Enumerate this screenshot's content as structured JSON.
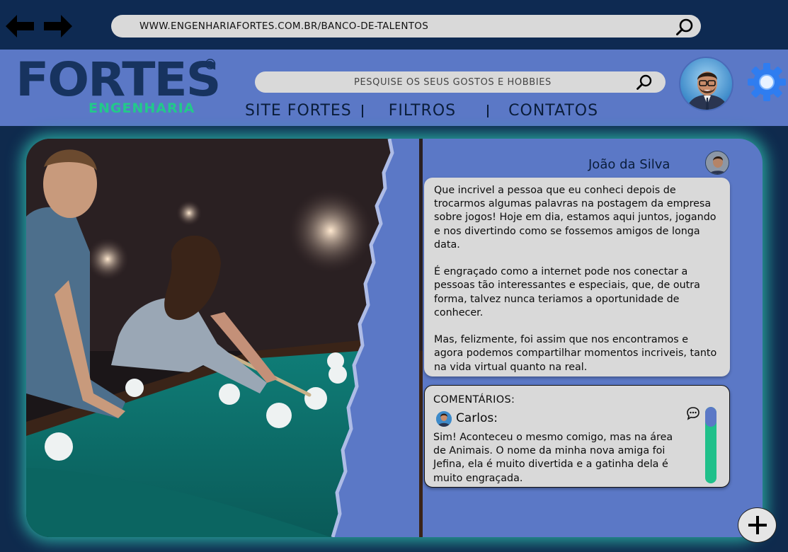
{
  "browser": {
    "url": "WWW.ENGENHARIAFORTES.COM.BR/BANCO-DE-TALENTOS",
    "back_icon": "arrow-left-icon",
    "forward_icon": "arrow-right-icon",
    "search_icon": "search-icon"
  },
  "header": {
    "logo_main": "FORTES",
    "logo_sub": "ENGENHARIA",
    "logo_reg": "®",
    "search_placeholder": "PESQUISE OS SEUS GOSTOS E HOBBIES",
    "menu": [
      {
        "label": "SITE FORTES"
      },
      {
        "label": "FILTROS"
      },
      {
        "label": "CONTATOS"
      }
    ],
    "settings_icon": "gear-icon"
  },
  "post": {
    "author": "João da Silva",
    "paragraphs": [
      "Que incrivel a pessoa que eu conheci depois de trocarmos algumas palavras na postagem da empresa sobre jogos! Hoje em dia, estamos aqui juntos, jogando e nos divertindo como se fossemos amigos de longa data.",
      "É engraçado como a internet pode nos conectar a pessoas tão interessantes e especiais, que, de outra forma, talvez nunca teriamos a oportunidade de conhecer.",
      "Mas, felizmente, foi assim que nos encontramos e agora podemos compartilhar momentos incriveis, tanto na vida virtual quanto na real."
    ]
  },
  "comments": {
    "title": "COMENTÁRIOS:",
    "items": [
      {
        "name": "Carlos:",
        "text": "Sim! Aconteceu o mesmo comigo, mas na área de Animais. O nome da minha nova amiga foi Jefina, ela é muito divertida e a gatinha dela é muito engraçada."
      }
    ],
    "scroll_position": 0
  },
  "actions": {
    "add_label": "+"
  },
  "colors": {
    "header_bg": "#5b78c6",
    "top_bar_bg": "#0e2a52",
    "accent_green": "#1fc08a",
    "logo_blue": "#17335f"
  }
}
